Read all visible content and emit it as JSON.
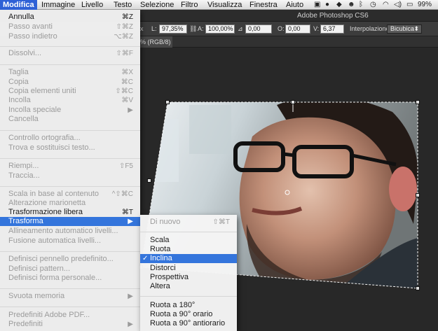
{
  "menubar": {
    "app_menu": "Modifica",
    "items": [
      "Immagine",
      "Livello",
      "Testo",
      "Selezione",
      "Filtro",
      "Visualizza",
      "Finestra",
      "Aiuto"
    ],
    "battery": "99%"
  },
  "window": {
    "title": "Adobe Photoshop CS6"
  },
  "options_bar": {
    "l_label": "L:",
    "l_value": "97,35%",
    "a_label": "A:",
    "a_value": "100,00%",
    "angle_value": "0,00",
    "o_label": "O:",
    "o_value": "0,00",
    "v_label": "V:",
    "v_value": "6,37",
    "interp_label": "Interpolazione:",
    "interp_value": "Bicubica"
  },
  "doc_tab": {
    "label": "% (RGB/8)"
  },
  "edit_menu": {
    "annulla": {
      "label": "Annulla",
      "shortcut": "⌘Z"
    },
    "passo_avanti": {
      "label": "Passo avanti",
      "shortcut": "⇧⌘Z"
    },
    "passo_indietro": {
      "label": "Passo indietro",
      "shortcut": "⌥⌘Z"
    },
    "dissolvi": {
      "label": "Dissolvi...",
      "shortcut": "⇧⌘F"
    },
    "taglia": {
      "label": "Taglia",
      "shortcut": "⌘X"
    },
    "copia": {
      "label": "Copia",
      "shortcut": "⌘C"
    },
    "copia_uniti": {
      "label": "Copia elementi uniti",
      "shortcut": "⇧⌘C"
    },
    "incolla": {
      "label": "Incolla",
      "shortcut": "⌘V"
    },
    "incolla_speciale": {
      "label": "Incolla speciale"
    },
    "cancella": {
      "label": "Cancella"
    },
    "controllo_ortografia": {
      "label": "Controllo ortografia..."
    },
    "trova_sostituisci": {
      "label": "Trova e sostituisci testo..."
    },
    "riempi": {
      "label": "Riempi...",
      "shortcut": "⇧F5"
    },
    "traccia": {
      "label": "Traccia..."
    },
    "scala_contenuto": {
      "label": "Scala in base al contenuto",
      "shortcut": "^⇧⌘C"
    },
    "alterazione_marionetta": {
      "label": "Alterazione marionetta"
    },
    "trasformazione_libera": {
      "label": "Trasformazione libera",
      "shortcut": "⌘T"
    },
    "trasforma": {
      "label": "Trasforma"
    },
    "allineamento_automatico": {
      "label": "Allineamento automatico livelli..."
    },
    "fusione_automatica": {
      "label": "Fusione automatica livelli..."
    },
    "definisci_pennello": {
      "label": "Definisci pennello predefinito..."
    },
    "definisci_pattern": {
      "label": "Definisci pattern..."
    },
    "definisci_forma": {
      "label": "Definisci forma personale..."
    },
    "svuota_memoria": {
      "label": "Svuota memoria"
    },
    "predefiniti_pdf": {
      "label": "Predefiniti Adobe PDF..."
    },
    "predefiniti": {
      "label": "Predefiniti"
    }
  },
  "transform_submenu": {
    "di_nuovo": {
      "label": "Di nuovo",
      "shortcut": "⇧⌘T"
    },
    "scala": {
      "label": "Scala"
    },
    "ruota": {
      "label": "Ruota"
    },
    "inclina": {
      "label": "Inclina",
      "check": "✓"
    },
    "distorci": {
      "label": "Distorci"
    },
    "prospettiva": {
      "label": "Prospettiva"
    },
    "altera": {
      "label": "Altera"
    },
    "ruota_180": {
      "label": "Ruota a 180°"
    },
    "ruota_90_orario": {
      "label": "Ruota a 90° orario"
    },
    "ruota_90_antiorario": {
      "label": "Ruota a 90° antiorario"
    }
  },
  "colors": {
    "highlight": "#3475dc",
    "menubar_active": "#2f61d6"
  }
}
